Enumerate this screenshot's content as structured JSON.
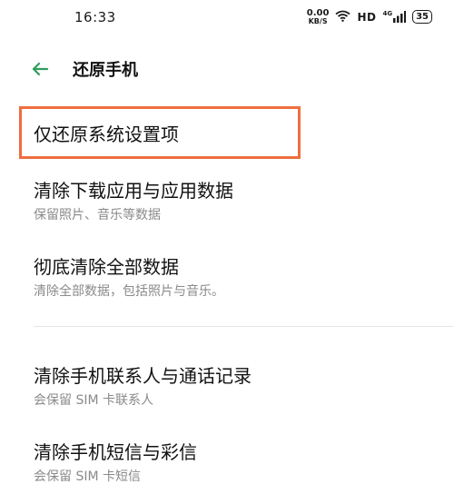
{
  "status_bar": {
    "time": "16:33",
    "net_speed_value": "0.00",
    "net_speed_unit": "KB/S",
    "hd_label": "HD",
    "network_type": "4G",
    "battery": "35"
  },
  "header": {
    "title": "还原手机"
  },
  "options": [
    {
      "title": "仅还原系统设置项",
      "subtitle": ""
    },
    {
      "title": "清除下载应用与应用数据",
      "subtitle": "保留照片、音乐等数据"
    },
    {
      "title": "彻底清除全部数据",
      "subtitle": "清除全部数据，包括照片与音乐。"
    },
    {
      "title": "清除手机联系人与通话记录",
      "subtitle": "会保留 SIM 卡联系人"
    },
    {
      "title": "清除手机短信与彩信",
      "subtitle": "会保留 SIM 卡短信"
    }
  ],
  "colors": {
    "accent": "#2e9e5b",
    "highlight": "#ee6e3f",
    "subtitle": "#8a8a8a"
  }
}
